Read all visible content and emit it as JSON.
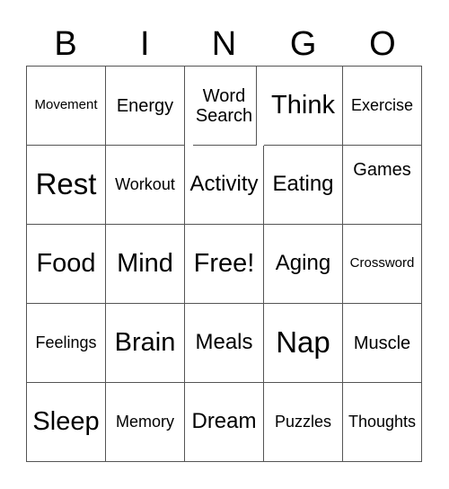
{
  "header": {
    "letters": [
      "B",
      "I",
      "N",
      "G",
      "O"
    ]
  },
  "card": {
    "rows": [
      [
        "Movement",
        "Energy",
        "Word Search",
        "Think",
        "Exercise"
      ],
      [
        "Rest",
        "Workout",
        "Activity",
        "Eating",
        "Games"
      ],
      [
        "Food",
        "Mind",
        "Free!",
        "Aging",
        "Crossword"
      ],
      [
        "Feelings",
        "Brain",
        "Meals",
        "Nap",
        "Muscle"
      ],
      [
        "Sleep",
        "Memory",
        "Dream",
        "Puzzles",
        "Thoughts"
      ]
    ],
    "free_space": "Free!"
  },
  "colors": {
    "text": "#000000",
    "grid_line": "#555555",
    "background": "#ffffff"
  }
}
